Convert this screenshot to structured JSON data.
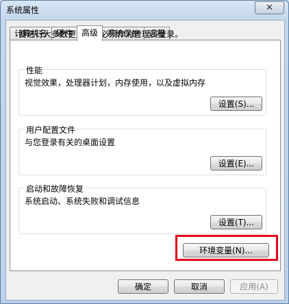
{
  "window": {
    "title": "系统属性",
    "close_symbol": "✕"
  },
  "tabs": [
    {
      "label": "计算机名",
      "active": false
    },
    {
      "label": "硬件",
      "active": false
    },
    {
      "label": "高级",
      "active": true
    },
    {
      "label": "系统保护",
      "active": false
    },
    {
      "label": "远程",
      "active": false
    }
  ],
  "advanced": {
    "admin_note": "要进行大多数更改，您必须作为管理员登录。",
    "performance": {
      "title": "性能",
      "description": "视觉效果，处理器计划，内存使用，以及虚拟内存",
      "button": "设置(S)..."
    },
    "user_profiles": {
      "title": "用户配置文件",
      "description": "与您登录有关的桌面设置",
      "button": "设置(E)..."
    },
    "startup_recovery": {
      "title": "启动和故障恢复",
      "description": "系统启动、系统失败和调试信息",
      "button": "设置(T)..."
    },
    "env_vars_button": "环境变量(N)..."
  },
  "footer": {
    "ok": "确定",
    "cancel": "取消",
    "apply": "应用(A)"
  },
  "colors": {
    "highlight": "#e4001b"
  }
}
